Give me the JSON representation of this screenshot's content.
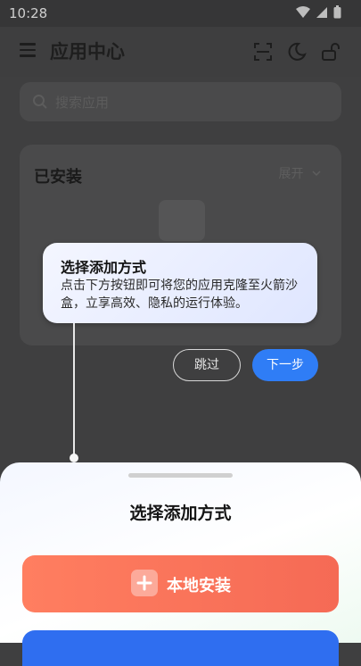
{
  "status_bar": {
    "time": "10:28"
  },
  "app_bar": {
    "title": "应用中心"
  },
  "search": {
    "placeholder": "搜索应用"
  },
  "installed": {
    "title": "已安装",
    "expand_label": "展开"
  },
  "guide": {
    "title": "选择添加方式",
    "body": "点击下方按钮即可将您的应用克隆至火箭沙盒，立享高效、隐私的运行体验。",
    "skip_label": "跳过",
    "next_label": "下一步"
  },
  "sheet": {
    "title": "选择添加方式",
    "local_install_label": "本地安装"
  },
  "colors": {
    "accent": "#2f7df6",
    "local_install": "#f56a55"
  }
}
